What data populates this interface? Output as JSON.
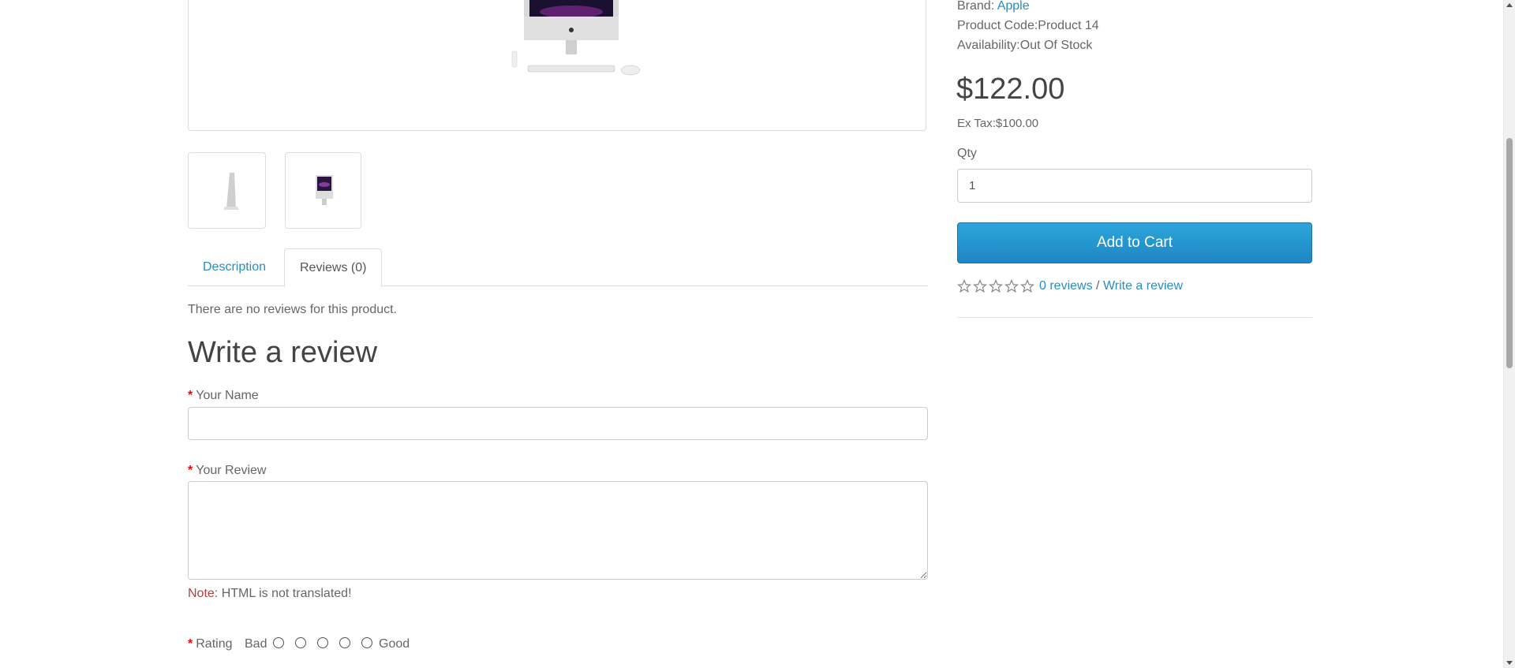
{
  "product_info": {
    "brand_label": "Brand:",
    "brand_value": "Apple",
    "code_label": "Product Code:",
    "code_value": "Product 14",
    "availability_label": "Availability:",
    "availability_value": "Out Of Stock",
    "price": "$122.00",
    "ex_tax_label": "Ex Tax:",
    "ex_tax_value": "$100.00",
    "qty_label": "Qty",
    "qty_value": "1",
    "add_to_cart": "Add to Cart",
    "reviews_link": "0 reviews",
    "separator": "/",
    "write_review_link": "Write a review",
    "star_icon": "star-outline-icon",
    "accent_color": "#2a8cc3"
  },
  "tabs": [
    {
      "label": "Description",
      "active": false
    },
    {
      "label": "Reviews (0)",
      "active": true
    }
  ],
  "reviews": {
    "empty_message": "There are no reviews for this product.",
    "heading": "Write a review",
    "required_marker": "*",
    "name_label": "Your Name",
    "name_value": "",
    "review_label": "Your Review",
    "review_value": "",
    "note_key": "Note:",
    "note_text": "HTML is not translated!",
    "rating_label": "Rating",
    "rating_bad": "Bad",
    "rating_good": "Good"
  }
}
